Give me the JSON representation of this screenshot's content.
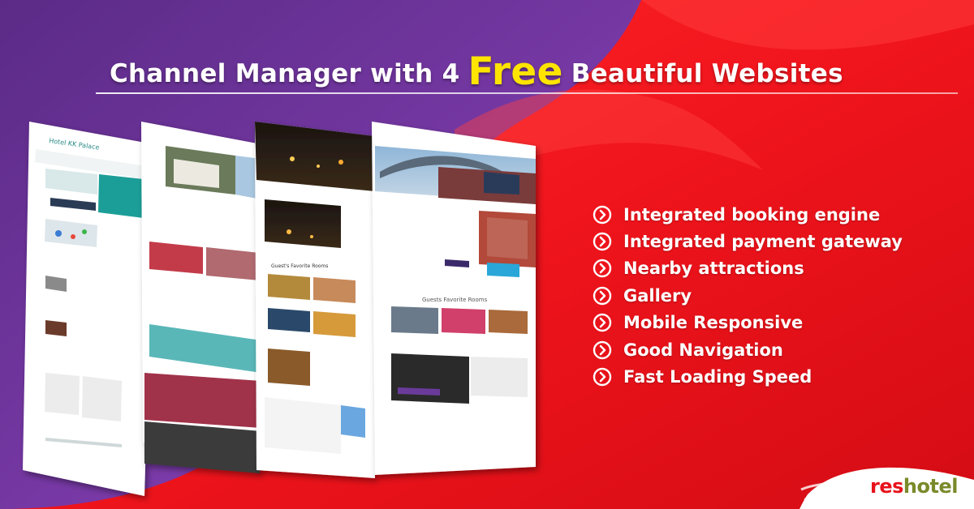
{
  "headline": {
    "before": "Channel Manager with 4",
    "highlight": "Free",
    "after": "Beautiful Websites"
  },
  "features": [
    "Integrated booking engine",
    "Integrated payment gateway",
    "Nearby attractions",
    "Gallery",
    "Mobile Responsive",
    "Good Navigation",
    "Fast Loading Speed"
  ],
  "brand": {
    "part1": "res",
    "part2": "hotel"
  },
  "mockups": {
    "site1_title": "Hotel KK Palace",
    "site3_section": "Guest's Favorite Rooms",
    "site4_heading": "Guests Favorite Rooms"
  },
  "colors": {
    "purple": "#6a2f9a",
    "red": "#e8121b",
    "yellow": "#ffe400",
    "brand_green": "#7a8a2a"
  },
  "icons": [
    "chevron-circle-icon"
  ]
}
